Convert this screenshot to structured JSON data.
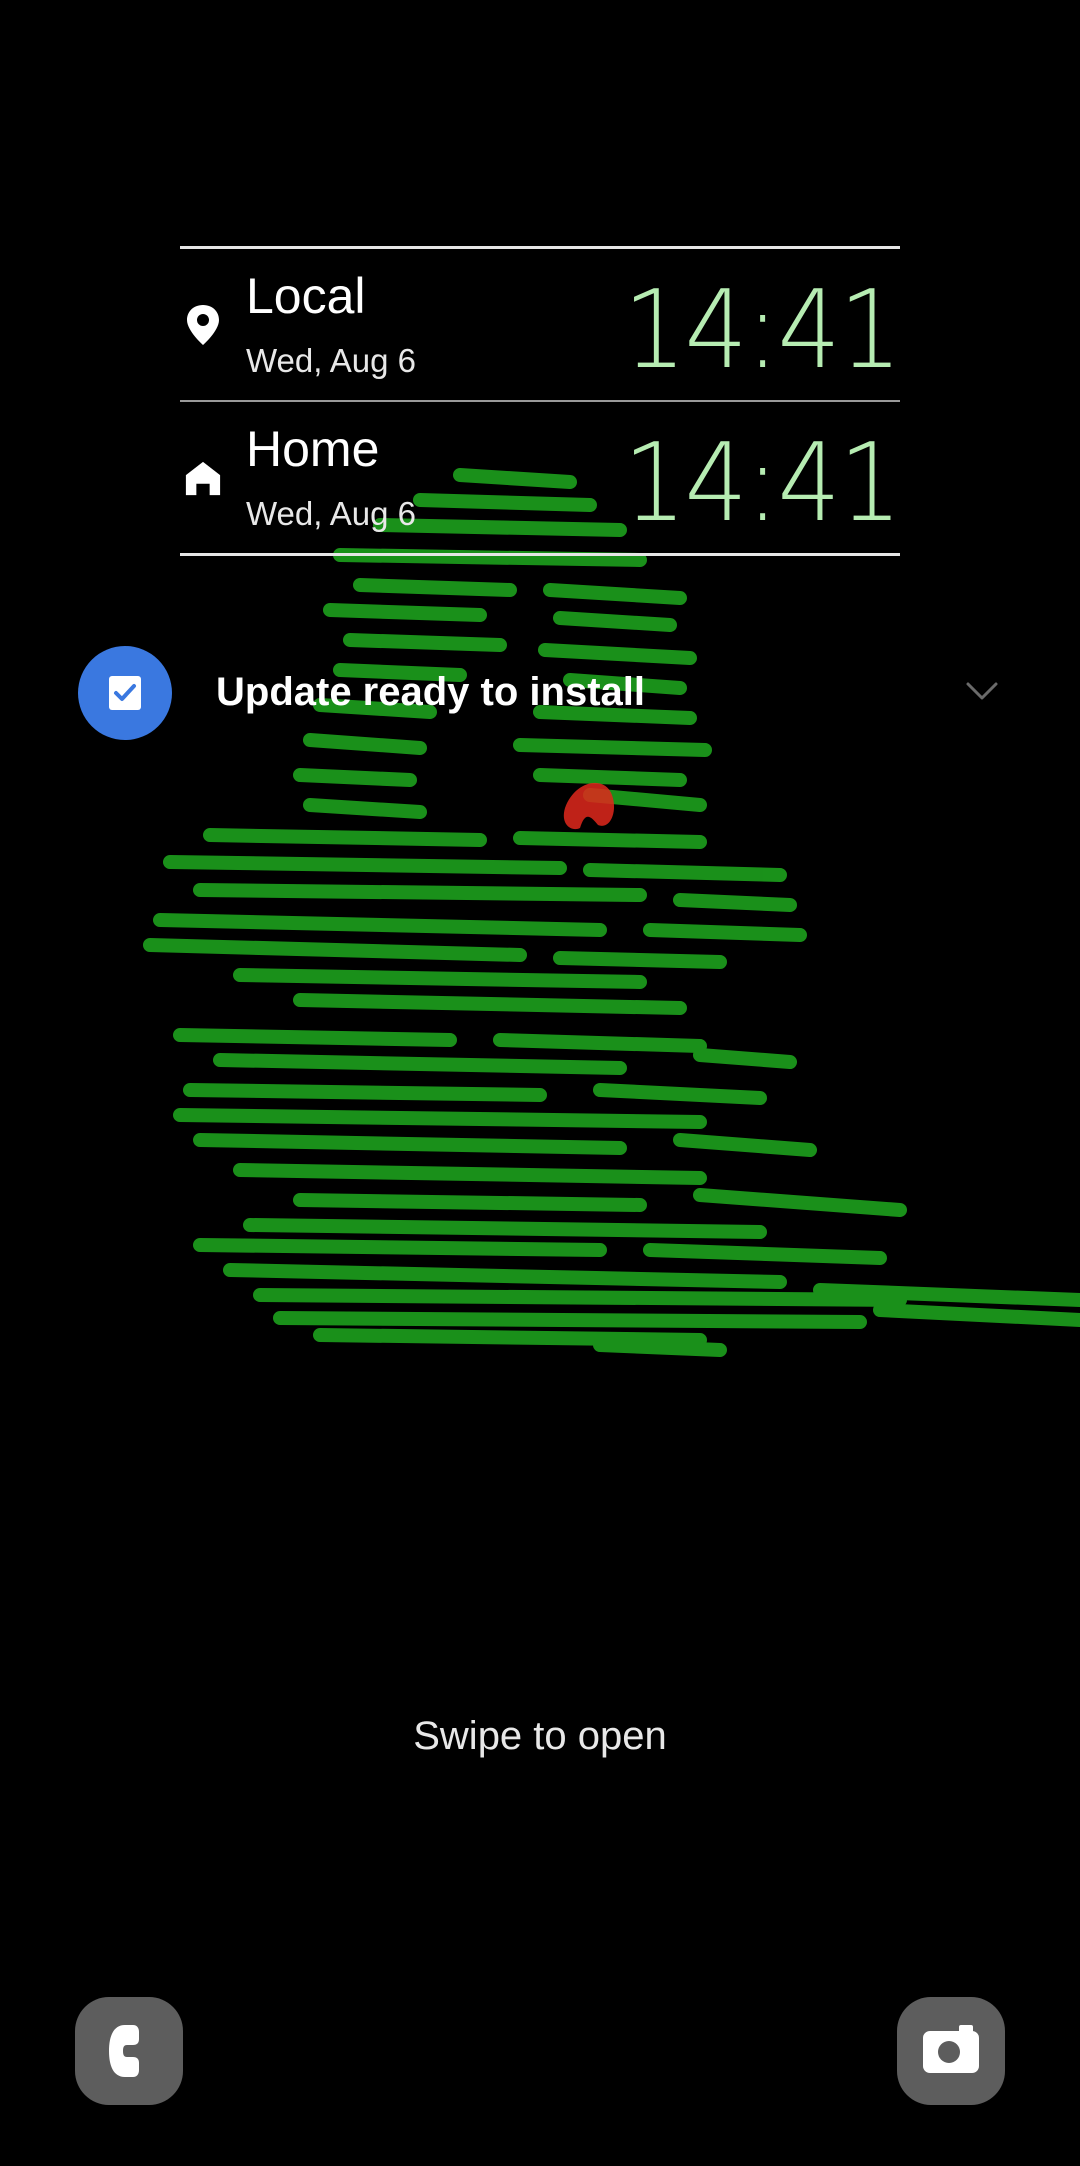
{
  "clock_widget": {
    "rows": [
      {
        "icon": "location-pin-icon",
        "city": "Local",
        "date": "Wed, Aug 6",
        "time": "14:41"
      },
      {
        "icon": "home-icon",
        "city": "Home",
        "date": "Wed, Aug 6",
        "time": "14:41"
      }
    ]
  },
  "notification": {
    "icon": "checkbox-update-icon",
    "title": "Update ready to install",
    "expand_icon": "chevron-down-icon"
  },
  "lock_hint": "Swipe to open",
  "shortcuts": {
    "left": "phone-icon",
    "right": "camera-icon"
  },
  "colors": {
    "background": "#000000",
    "clock_time": "#b6ecb2",
    "notification_icon_bg": "#3a78e0",
    "shortcut_bg": "#5d5d5d",
    "wallpaper_strokes": "#23c423",
    "wallpaper_accent": "#e0281c"
  }
}
